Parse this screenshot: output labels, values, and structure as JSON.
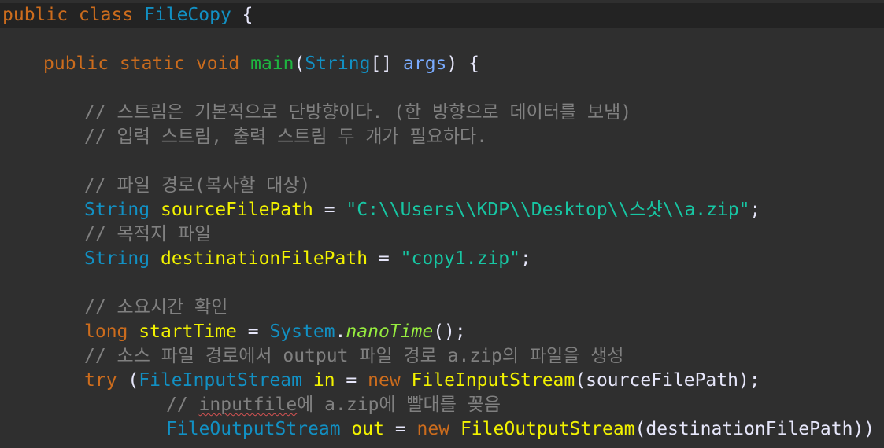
{
  "code": {
    "l1": {
      "kw": "public class",
      "cls": "FileCopy",
      "brace": "{"
    },
    "l2": {
      "kw": "public static void",
      "fn": "main",
      "p1": "(",
      "type": "String",
      "arr": "[]",
      "param": "args",
      "p2": ") {"
    },
    "l3": {
      "comment": "// 스트림은 기본적으로 단방향이다. (한 방향으로 데이터를 보냄)"
    },
    "l4": {
      "comment": "// 입력 스트림, 출력 스트림 두 개가 필요하다."
    },
    "l5": {
      "comment": "// 파일 경로(복사할 대상)"
    },
    "l6": {
      "type": "String",
      "var": "sourceFilePath",
      "eq": "=",
      "str": "\"C:\\\\Users\\\\KDP\\\\Desktop\\\\스샷\\\\a.zip\"",
      "semi": ";"
    },
    "l7": {
      "comment": "// 목적지 파일"
    },
    "l8": {
      "type": "String",
      "var": "destinationFilePath",
      "eq": "=",
      "str": "\"copy1.zip\"",
      "semi": ";"
    },
    "l9": {
      "comment": "// 소요시간 확인"
    },
    "l10": {
      "kw": "long",
      "var": "startTime",
      "eq": "=",
      "cls": "System",
      "dot": ".",
      "method": "nanoTime",
      "end": "();"
    },
    "l11": {
      "comment": "// 소스 파일 경로에서 output 파일 경로 a.zip의 파일을 생성"
    },
    "l12": {
      "kw": "try",
      "p1": "(",
      "cls": "FileInputStream",
      "var": "in",
      "eq": "=",
      "kw2": "new",
      "ctor": "FileInputStream",
      "args": "(sourceFilePath);"
    },
    "l13": {
      "c1": "// ",
      "squig": "inputfile",
      "c2": "에 a.zip에 빨대를 꽂음"
    },
    "l14": {
      "cls": "FileOutputStream",
      "var": "out",
      "eq": "=",
      "kw": "new",
      "ctor": "FileOutputStream",
      "args": "(destinationFilePath)) {"
    }
  }
}
